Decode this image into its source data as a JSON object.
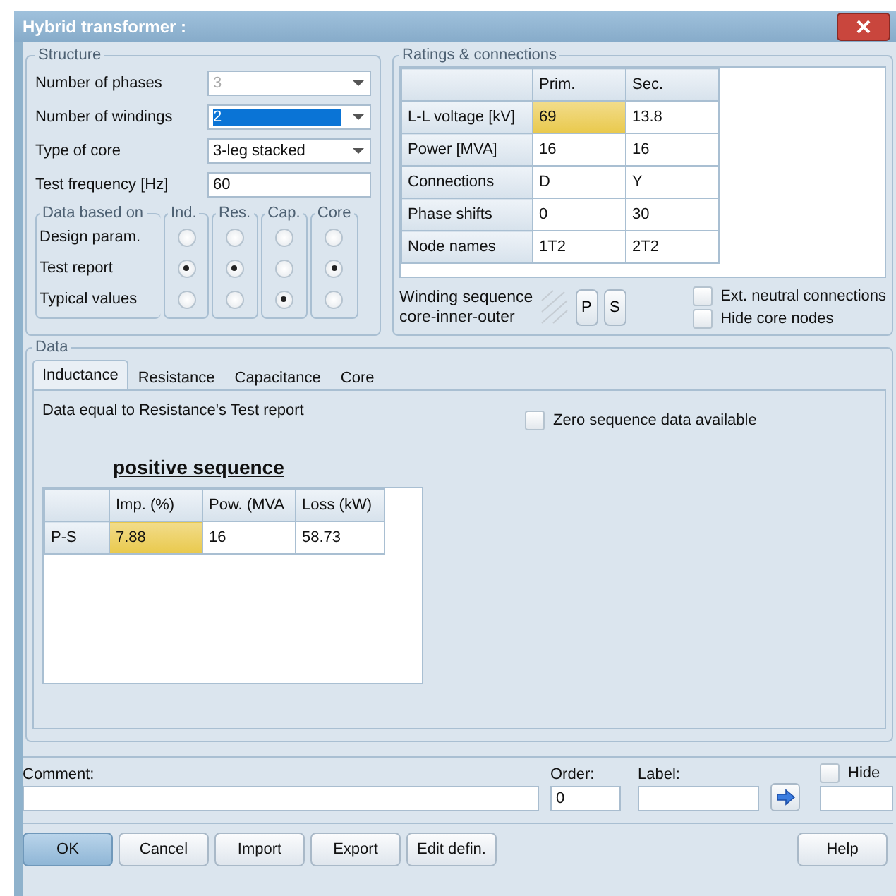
{
  "window": {
    "title": "Hybrid transformer :"
  },
  "structure": {
    "title": "Structure",
    "fields": [
      {
        "label": "Number of phases",
        "value": "3",
        "kind": "dropdown",
        "disabled": true,
        "focused": false
      },
      {
        "label": "Number of windings",
        "value": "2",
        "kind": "dropdown",
        "disabled": false,
        "focused": true
      },
      {
        "label": "Type of core",
        "value": "3-leg stacked",
        "kind": "dropdown",
        "disabled": false,
        "focused": false
      },
      {
        "label": "Test frequency [Hz]",
        "value": "60",
        "kind": "text",
        "disabled": false,
        "focused": false
      }
    ],
    "data_based_on": {
      "title": "Data based on",
      "columns": [
        "Ind.",
        "Res.",
        "Cap.",
        "Core"
      ],
      "rows": [
        {
          "label": "Design param.",
          "options": [
            {
              "selected": false
            },
            {
              "selected": false
            },
            {
              "selected": false
            },
            {
              "selected": false
            }
          ]
        },
        {
          "label": "Test report",
          "options": [
            {
              "selected": true
            },
            {
              "selected": true
            },
            {
              "selected": false
            },
            {
              "selected": true
            }
          ]
        },
        {
          "label": "Typical values",
          "options": [
            {
              "selected": false
            },
            {
              "selected": false
            },
            {
              "selected": true
            },
            {
              "selected": false
            }
          ]
        }
      ]
    }
  },
  "ratings": {
    "title": "Ratings & connections",
    "columns": [
      "Prim.",
      "Sec."
    ],
    "rows": [
      {
        "label": "L-L voltage [kV]",
        "cells": [
          {
            "text": "69",
            "selected": true
          },
          {
            "text": "13.8",
            "selected": false
          }
        ]
      },
      {
        "label": "Power [MVA]",
        "cells": [
          {
            "text": "16",
            "selected": false
          },
          {
            "text": "16",
            "selected": false
          }
        ]
      },
      {
        "label": "Connections",
        "cells": [
          {
            "text": "D",
            "selected": false
          },
          {
            "text": "Y",
            "selected": false
          }
        ]
      },
      {
        "label": "Phase shifts",
        "cells": [
          {
            "text": "0",
            "selected": false
          },
          {
            "text": "30",
            "selected": false
          }
        ]
      },
      {
        "label": "Node names",
        "cells": [
          {
            "text": "1T2",
            "selected": false
          },
          {
            "text": "2T2",
            "selected": false
          }
        ]
      }
    ],
    "winding_sequence": {
      "lines": [
        "Winding sequence",
        "core-inner-outer"
      ],
      "buttons": [
        "P",
        "S"
      ]
    },
    "checkboxes": [
      {
        "label": "Ext. neutral connections",
        "checked": false
      },
      {
        "label": "Hide core nodes",
        "checked": false
      }
    ]
  },
  "data": {
    "title": "Data",
    "tabs": [
      {
        "label": "Inductance",
        "selected": true
      },
      {
        "label": "Resistance",
        "selected": false
      },
      {
        "label": "Capacitance",
        "selected": false
      },
      {
        "label": "Core",
        "selected": false
      }
    ],
    "note": "Data equal to Resistance's Test report",
    "zero_sequence": {
      "label": "Zero sequence data available",
      "checked": false
    },
    "section_title": "positive sequence",
    "table": {
      "columns": [
        "Imp. (%)",
        "Pow. (MVA",
        "Loss (kW)"
      ],
      "rows": [
        {
          "label": "P-S",
          "cells": [
            {
              "text": "7.88",
              "selected": true
            },
            {
              "text": "16",
              "selected": false
            },
            {
              "text": "58.73",
              "selected": false
            }
          ]
        }
      ]
    }
  },
  "footer": {
    "comment": {
      "label": "Comment:"
    },
    "order": {
      "label": "Order:",
      "value": "0"
    },
    "label": {
      "label": "Label:"
    },
    "hide": {
      "label": "Hide",
      "checked": false
    },
    "buttons": [
      {
        "label": "OK",
        "default": true
      },
      {
        "label": "Cancel",
        "default": false
      },
      {
        "label": "Import",
        "default": false
      },
      {
        "label": "Export",
        "default": false
      },
      {
        "label": "Edit defin.",
        "default": false
      },
      {
        "label": "Help",
        "default": false
      }
    ]
  }
}
